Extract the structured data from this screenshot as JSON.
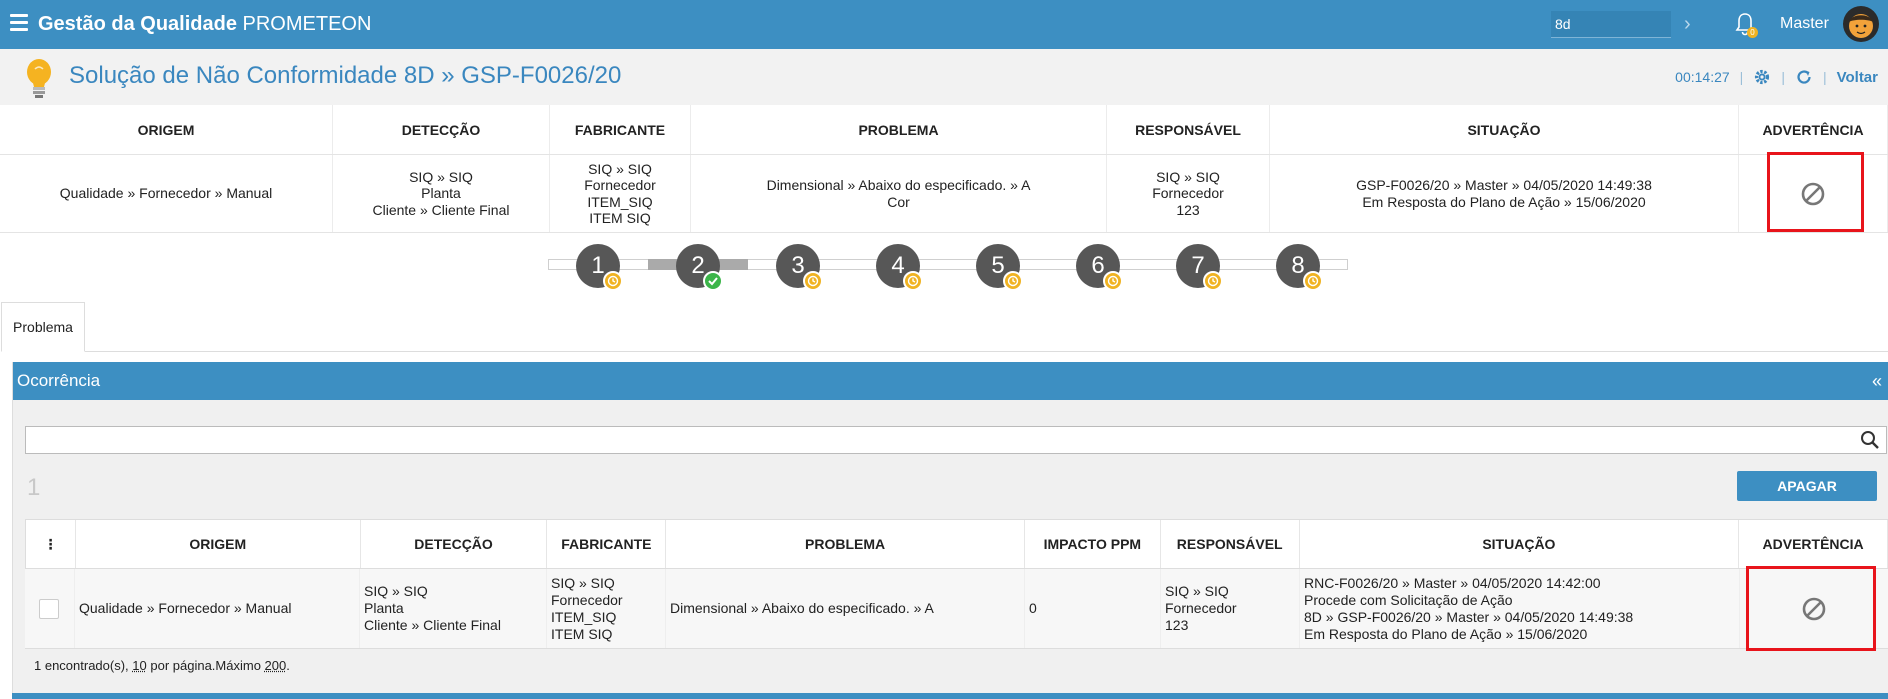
{
  "topbar": {
    "title_bold": "Gestão da Qualidade",
    "title_rest": " PROMETEON",
    "search_value": "8d",
    "notifications_count": "0",
    "user_name": "Master"
  },
  "page": {
    "title": "Solução de Não Conformidade 8D » GSP-F0026/20",
    "timer": "00:14:27",
    "voltar": "Voltar"
  },
  "summary": {
    "headers": [
      "ORIGEM",
      "DETECÇÃO",
      "FABRICANTE",
      "PROBLEMA",
      "RESPONSÁVEL",
      "SITUAÇÃO",
      "ADVERTÊNCIA"
    ],
    "values": [
      "Qualidade » Fornecedor » Manual",
      "SIQ » SIQ\nPlanta\nCliente » Cliente Final",
      "SIQ » SIQ\nFornecedor\nITEM_SIQ\nITEM SIQ",
      "Dimensional » Abaixo do especificado. » A\nCor",
      "SIQ » SIQ\nFornecedor\n123",
      "GSP-F0026/20 » Master » 04/05/2020 14:49:38\nEm Resposta do Plano de Ação » 15/06/2020",
      ""
    ]
  },
  "steps": [
    {
      "label": "1",
      "status": "pending"
    },
    {
      "label": "2",
      "status": "done"
    },
    {
      "label": "3",
      "status": "pending"
    },
    {
      "label": "4",
      "status": "pending"
    },
    {
      "label": "5",
      "status": "pending"
    },
    {
      "label": "6",
      "status": "pending"
    },
    {
      "label": "7",
      "status": "pending"
    },
    {
      "label": "8",
      "status": "pending"
    }
  ],
  "tabs": [
    {
      "label": "Problema"
    }
  ],
  "panel": {
    "title": "Ocorrência",
    "collapse": "«",
    "count": "1",
    "delete_label": "APAGAR",
    "grid_headers": [
      "⋮",
      "ORIGEM",
      "DETECÇÃO",
      "FABRICANTE",
      "PROBLEMA",
      "IMPACTO PPM",
      "RESPONSÁVEL",
      "SITUAÇÃO",
      "ADVERTÊNCIA"
    ],
    "rows": [
      {
        "origem": "Qualidade » Fornecedor » Manual",
        "deteccao": "SIQ » SIQ\nPlanta\nCliente » Cliente Final",
        "fabricante": "SIQ » SIQ\nFornecedor\nITEM_SIQ\nITEM SIQ",
        "problema": "Dimensional » Abaixo do especificado. » A",
        "impacto": "0",
        "responsavel": "SIQ » SIQ\nFornecedor\n123",
        "situacao": "RNC-F0026/20 » Master » 04/05/2020 14:42:00\nProcede com Solicitação de Ação\n8D » GSP-F0026/20 » Master » 04/05/2020 14:49:38\nEm Resposta do Plano de Ação » 15/06/2020"
      }
    ],
    "footer": {
      "found": "1 encontrado(s), ",
      "per_page": "10",
      "per_page_suffix": " por página.",
      "max_label": "Máximo ",
      "max": "200",
      "end": "."
    }
  },
  "colors": {
    "primary": "#3d8fc2",
    "pending": "#f0b323",
    "done": "#3cb54a",
    "highlight": "#e8141b"
  },
  "icons": [
    "menu-icon",
    "chevron-right-icon",
    "bell-icon",
    "lightbulb-icon",
    "gear-icon",
    "refresh-icon",
    "no-entry-icon",
    "search-icon",
    "clock-icon",
    "check-icon"
  ]
}
